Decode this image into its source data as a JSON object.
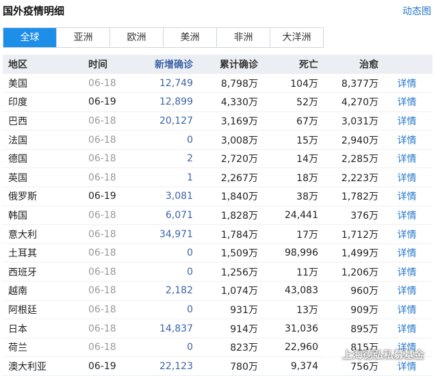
{
  "header": {
    "title": "国外疫情明细",
    "dynamic_link": "动态图"
  },
  "tabs": [
    {
      "label": "全球",
      "active": true
    },
    {
      "label": "亚洲",
      "active": false
    },
    {
      "label": "欧洲",
      "active": false
    },
    {
      "label": "美洲",
      "active": false
    },
    {
      "label": "非洲",
      "active": false
    },
    {
      "label": "大洋洲",
      "active": false
    }
  ],
  "table": {
    "columns": [
      "地区",
      "时间",
      "新增确诊",
      "累计确诊",
      "死亡",
      "治愈"
    ],
    "detail_label": "详情",
    "rows": [
      {
        "region": "美国",
        "time": "06-18",
        "time_current": false,
        "new": "12,749",
        "total": "8,798万",
        "deaths": "104万",
        "recovered": "8,377万"
      },
      {
        "region": "印度",
        "time": "06-19",
        "time_current": true,
        "new": "12,899",
        "total": "4,330万",
        "deaths": "52万",
        "recovered": "4,270万"
      },
      {
        "region": "巴西",
        "time": "06-18",
        "time_current": false,
        "new": "20,127",
        "total": "3,169万",
        "deaths": "67万",
        "recovered": "3,031万"
      },
      {
        "region": "法国",
        "time": "06-18",
        "time_current": false,
        "new": "0",
        "total": "3,008万",
        "deaths": "15万",
        "recovered": "2,940万"
      },
      {
        "region": "德国",
        "time": "06-18",
        "time_current": false,
        "new": "2",
        "total": "2,720万",
        "deaths": "14万",
        "recovered": "2,285万"
      },
      {
        "region": "英国",
        "time": "06-18",
        "time_current": false,
        "new": "1",
        "total": "2,267万",
        "deaths": "18万",
        "recovered": "2,223万"
      },
      {
        "region": "俄罗斯",
        "time": "06-19",
        "time_current": true,
        "new": "3,081",
        "total": "1,840万",
        "deaths": "38万",
        "recovered": "1,782万"
      },
      {
        "region": "韩国",
        "time": "06-18",
        "time_current": false,
        "new": "6,071",
        "total": "1,828万",
        "deaths": "24,441",
        "recovered": "376万"
      },
      {
        "region": "意大利",
        "time": "06-18",
        "time_current": false,
        "new": "34,971",
        "total": "1,784万",
        "deaths": "17万",
        "recovered": "1,712万"
      },
      {
        "region": "土耳其",
        "time": "06-18",
        "time_current": false,
        "new": "0",
        "total": "1,509万",
        "deaths": "98,996",
        "recovered": "1,499万"
      },
      {
        "region": "西班牙",
        "time": "06-18",
        "time_current": false,
        "new": "0",
        "total": "1,256万",
        "deaths": "11万",
        "recovered": "1,206万"
      },
      {
        "region": "越南",
        "time": "06-18",
        "time_current": false,
        "new": "2,182",
        "total": "1,074万",
        "deaths": "43,083",
        "recovered": "960万"
      },
      {
        "region": "阿根廷",
        "time": "06-18",
        "time_current": false,
        "new": "0",
        "total": "931万",
        "deaths": "13万",
        "recovered": "909万"
      },
      {
        "region": "日本",
        "time": "06-18",
        "time_current": false,
        "new": "14,837",
        "total": "914万",
        "deaths": "31,036",
        "recovered": "895万"
      },
      {
        "region": "荷兰",
        "time": "06-18",
        "time_current": false,
        "new": "0",
        "total": "823万",
        "deaths": "22,960",
        "recovered": "815万"
      },
      {
        "region": "澳大利亚",
        "time": "06-19",
        "time_current": true,
        "new": "22,123",
        "total": "780万",
        "deaths": "9,374",
        "recovered": "756万"
      }
    ]
  },
  "watermark": {
    "text": "上海德弘私募基金",
    "icon": "wechat-icon"
  },
  "colors": {
    "accent": "#1e8fe8",
    "link": "#2477c8",
    "new_cases": "#3d63a8",
    "header_bg": "#ebeef2"
  }
}
